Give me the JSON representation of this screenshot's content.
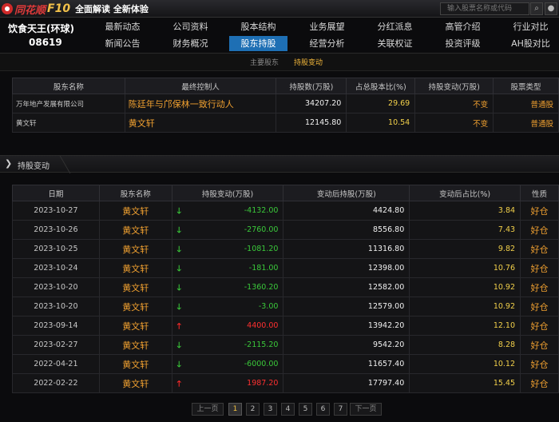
{
  "header": {
    "brand": "同花顺",
    "f10": "F10",
    "slogan": "全面解读 全新体验",
    "search_placeholder": "输入股票名称或代码",
    "search_icon": "search-icon",
    "user_icon": "user-icon"
  },
  "stock": {
    "name": "饮食天王(环球)",
    "code": "08619"
  },
  "nav": {
    "row1": [
      "最新动态",
      "公司资料",
      "股本结构",
      "业务展望",
      "分红派息",
      "高管介绍",
      "行业对比"
    ],
    "row2": [
      "新闻公告",
      "财务概况",
      "股东持股",
      "经营分析",
      "关联权证",
      "投资评级",
      "AH股对比"
    ],
    "active": "股东持股"
  },
  "subtabs": [
    "主要股东",
    "持股变动"
  ],
  "subtab_active": "持股变动",
  "major": {
    "headers": [
      "股东名称",
      "最终控制人",
      "持股数(万股)",
      "占总股本比(%)",
      "持股变动(万股)",
      "股票类型"
    ],
    "rows": [
      [
        "万年地产发展有限公司",
        "陈廷年与邝保林一致行动人",
        "34207.20",
        "29.69",
        "不变",
        "普通股"
      ],
      [
        "黄文轩",
        "黄文轩",
        "12145.80",
        "10.54",
        "不变",
        "普通股"
      ]
    ]
  },
  "section": {
    "title": "持股变动"
  },
  "changes": {
    "headers": [
      "日期",
      "股东名称",
      "持股变动(万股)",
      "变动后持股(万股)",
      "变动后占比(%)",
      "性质"
    ],
    "rows": [
      {
        "date": "2023-10-27",
        "name": "黄文轩",
        "dir": "down",
        "change": "-4132.00",
        "after": "4424.80",
        "pct": "3.84",
        "nature": "好仓"
      },
      {
        "date": "2023-10-26",
        "name": "黄文轩",
        "dir": "down",
        "change": "-2760.00",
        "after": "8556.80",
        "pct": "7.43",
        "nature": "好仓"
      },
      {
        "date": "2023-10-25",
        "name": "黄文轩",
        "dir": "down",
        "change": "-1081.20",
        "after": "11316.80",
        "pct": "9.82",
        "nature": "好仓"
      },
      {
        "date": "2023-10-24",
        "name": "黄文轩",
        "dir": "down",
        "change": "-181.00",
        "after": "12398.00",
        "pct": "10.76",
        "nature": "好仓"
      },
      {
        "date": "2023-10-20",
        "name": "黄文轩",
        "dir": "down",
        "change": "-1360.20",
        "after": "12582.00",
        "pct": "10.92",
        "nature": "好仓"
      },
      {
        "date": "2023-10-20",
        "name": "黄文轩",
        "dir": "down",
        "change": "-3.00",
        "after": "12579.00",
        "pct": "10.92",
        "nature": "好仓"
      },
      {
        "date": "2023-09-14",
        "name": "黄文轩",
        "dir": "up",
        "change": "4400.00",
        "after": "13942.20",
        "pct": "12.10",
        "nature": "好仓"
      },
      {
        "date": "2023-02-27",
        "name": "黄文轩",
        "dir": "down",
        "change": "-2115.20",
        "after": "9542.20",
        "pct": "8.28",
        "nature": "好仓"
      },
      {
        "date": "2022-04-21",
        "name": "黄文轩",
        "dir": "down",
        "change": "-6000.00",
        "after": "11657.40",
        "pct": "10.12",
        "nature": "好仓"
      },
      {
        "date": "2022-02-22",
        "name": "黄文轩",
        "dir": "up",
        "change": "1987.20",
        "after": "17797.40",
        "pct": "15.45",
        "nature": "好仓"
      }
    ]
  },
  "pager": {
    "prev": "上一页",
    "next": "下一页",
    "pages": [
      "1",
      "2",
      "3",
      "4",
      "5",
      "6",
      "7"
    ],
    "current": "1"
  }
}
